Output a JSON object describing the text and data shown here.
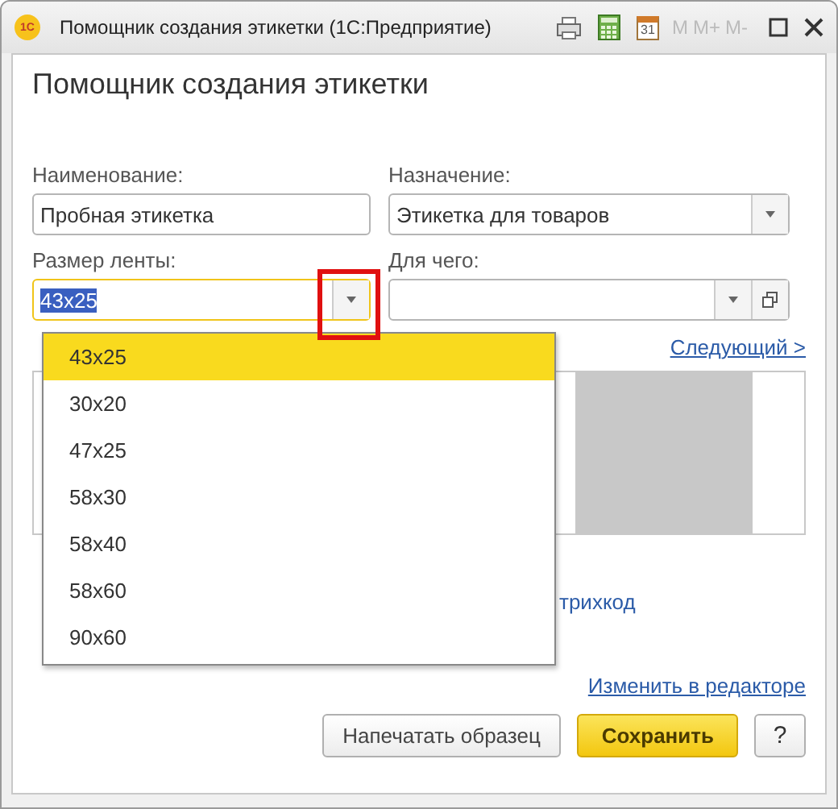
{
  "window": {
    "logo": "1С",
    "title": "Помощник создания этикетки  (1С:Предприятие)",
    "calendar_day": "31",
    "memory_buttons": [
      {
        "label": "M",
        "disabled": true
      },
      {
        "label": "M+",
        "disabled": true
      },
      {
        "label": "M-",
        "disabled": true
      }
    ]
  },
  "heading": "Помощник создания этикетки",
  "fields": [
    {
      "label": "Наименование:",
      "value": "Пробная этикетка",
      "kind": "text",
      "focused": false
    },
    {
      "label": "Назначение:",
      "value": "Этикетка для товаров",
      "kind": "select",
      "focused": false
    },
    {
      "label": "Размер ленты:",
      "value": "43x25",
      "kind": "select",
      "focused": true
    },
    {
      "label": "Для чего:",
      "kind": "select-open",
      "focused": false
    }
  ],
  "next_link": "Следующий >",
  "barcode_label": "трихкод",
  "edit_link": "Изменить в редакторе",
  "buttons": [
    {
      "label": "Напечатать образец",
      "kind": "default"
    },
    {
      "label": "Сохранить",
      "kind": "primary"
    },
    {
      "label": "?",
      "kind": "help"
    }
  ],
  "dropdown": {
    "items": [
      {
        "label": "43x25",
        "selected": true
      },
      {
        "label": "30x20",
        "selected": false
      },
      {
        "label": "47x25",
        "selected": false
      },
      {
        "label": "58x30",
        "selected": false
      },
      {
        "label": "58x40",
        "selected": false
      },
      {
        "label": "58x60",
        "selected": false
      },
      {
        "label": "90x60",
        "selected": false
      }
    ]
  },
  "highlight": true
}
